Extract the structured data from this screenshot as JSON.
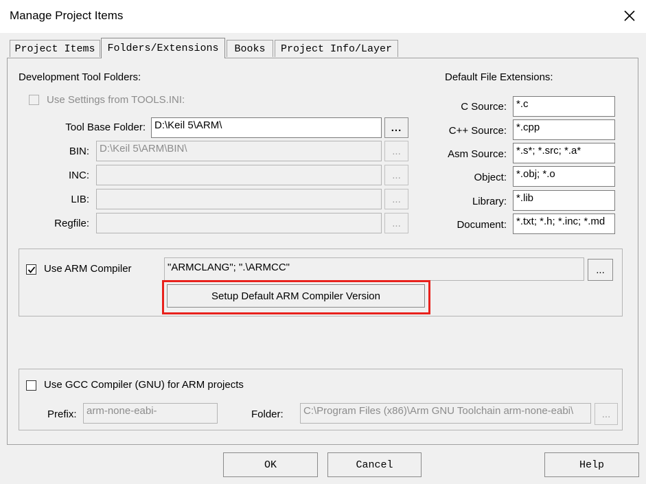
{
  "window": {
    "title": "Manage Project Items"
  },
  "icons": {
    "close": "close-icon",
    "check": "check-icon"
  },
  "colors": {
    "highlight": "#e8211c"
  },
  "tabs": [
    {
      "label": "Project Items",
      "active": false
    },
    {
      "label": "Folders/Extensions",
      "active": true
    },
    {
      "label": "Books",
      "active": false
    },
    {
      "label": "Project Info/Layer",
      "active": false
    }
  ],
  "dev_tools": {
    "heading": "Development Tool Folders:",
    "use_settings_label": "Use Settings from TOOLS.INI:",
    "use_settings_checked": false,
    "tool_base": {
      "label": "Tool Base Folder:",
      "value": "D:\\Keil 5\\ARM\\"
    },
    "bin": {
      "label": "BIN:",
      "value": "D:\\Keil 5\\ARM\\BIN\\"
    },
    "inc": {
      "label": "INC:",
      "value": ""
    },
    "lib": {
      "label": "LIB:",
      "value": ""
    },
    "regfile": {
      "label": "Regfile:",
      "value": ""
    },
    "browse_label": "..."
  },
  "extensions": {
    "heading": "Default File Extensions:",
    "c_source": {
      "label": "C Source:",
      "value": "*.c"
    },
    "cpp_source": {
      "label": "C++ Source:",
      "value": "*.cpp"
    },
    "asm_source": {
      "label": "Asm Source:",
      "value": "*.s*; *.src; *.a*"
    },
    "object": {
      "label": "Object:",
      "value": "*.obj; *.o"
    },
    "library": {
      "label": "Library:",
      "value": "*.lib"
    },
    "document": {
      "label": "Document:",
      "value": "*.txt; *.h; *.inc; *.md"
    }
  },
  "arm_compiler": {
    "label": "Use ARM Compiler",
    "checked": true,
    "value": "\"ARMCLANG\"; \".\\ARMCC\"",
    "browse_label": "...",
    "setup_button": "Setup Default ARM Compiler Version"
  },
  "gcc_compiler": {
    "label": "Use GCC Compiler (GNU) for ARM projects",
    "checked": false,
    "prefix_label": "Prefix:",
    "prefix_value": "arm-none-eabi-",
    "folder_label": "Folder:",
    "folder_value": "C:\\Program Files (x86)\\Arm GNU Toolchain arm-none-eabi\\",
    "browse_label": "..."
  },
  "footer": {
    "ok": "OK",
    "cancel": "Cancel",
    "help": "Help"
  }
}
